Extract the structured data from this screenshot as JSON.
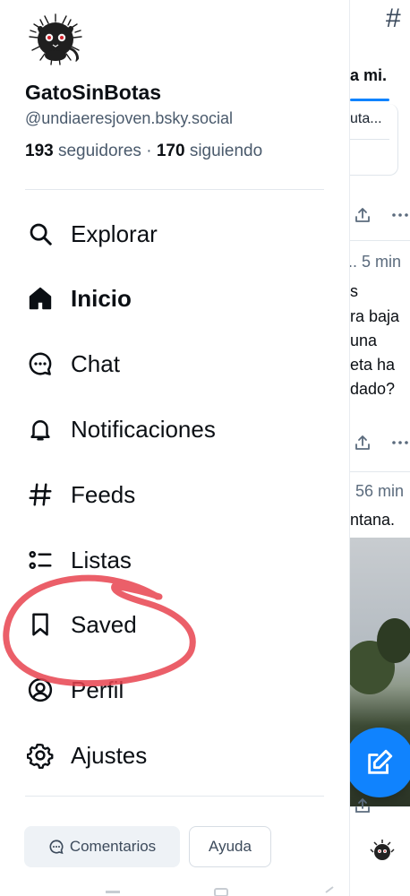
{
  "profile": {
    "display_name": "GatoSinBotas",
    "handle": "@undiaeresjoven.bsky.social",
    "followers_count": "193",
    "followers_label": "seguidores",
    "separator": "·",
    "following_count": "170",
    "following_label": "siguiendo"
  },
  "nav": {
    "items": [
      {
        "label": "Explorar",
        "icon": "search-icon"
      },
      {
        "label": "Inicio",
        "icon": "home-icon",
        "active": true
      },
      {
        "label": "Chat",
        "icon": "chat-icon"
      },
      {
        "label": "Notificaciones",
        "icon": "bell-icon"
      },
      {
        "label": "Feeds",
        "icon": "hash-icon"
      },
      {
        "label": "Listas",
        "icon": "list-icon"
      },
      {
        "label": "Saved",
        "icon": "bookmark-icon"
      },
      {
        "label": "Perfil",
        "icon": "user-circle-icon"
      },
      {
        "label": "Ajustes",
        "icon": "gear-icon"
      }
    ]
  },
  "footer": {
    "feedback_label": "Comentarios",
    "help_label": "Ayuda"
  },
  "feed_peek": {
    "tab_label": "a mi.",
    "quote_snippet": "uta...",
    "post1_time": ".. 5 min",
    "post1_lines": [
      "s",
      "ra baja",
      " una",
      "eta ha",
      "dado?"
    ],
    "post2_time": "56 min",
    "post2_line": "ntana."
  },
  "colors": {
    "accent": "#1083fe",
    "annotation": "#e8434f",
    "text_primary": "#0b0f14",
    "text_secondary": "#4a5a6c"
  }
}
